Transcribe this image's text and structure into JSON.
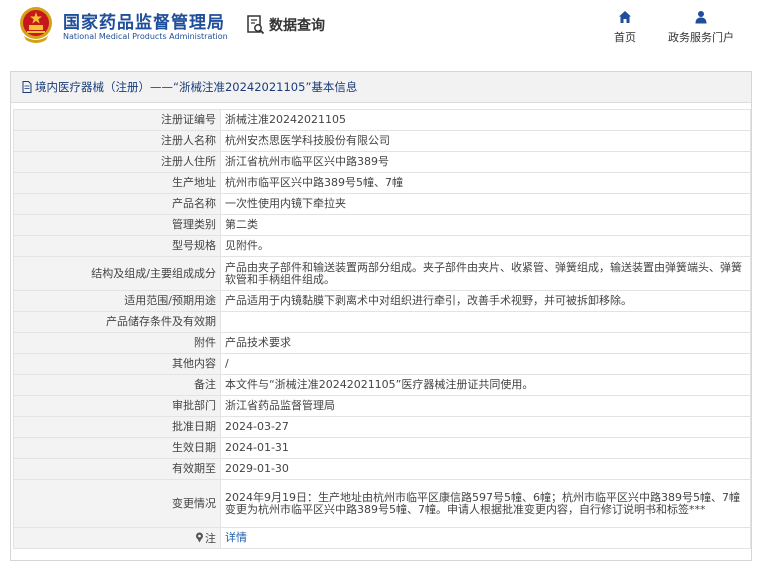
{
  "header": {
    "org_name_cn": "国家药品监督管理局",
    "org_name_en": "National Medical Products Administration",
    "section_title": "数据查询",
    "nav": [
      {
        "label": "首页",
        "icon": "home-icon"
      },
      {
        "label": "政务服务门户",
        "icon": "user-icon"
      }
    ]
  },
  "panel": {
    "title": "境内医疗器械（注册）——“浙械注准20242021105”基本信息"
  },
  "rows": [
    {
      "label": "注册证编号",
      "value": "浙械注准20242021105"
    },
    {
      "label": "注册人名称",
      "value": "杭州安杰思医学科技股份有限公司"
    },
    {
      "label": "注册人住所",
      "value": "浙江省杭州市临平区兴中路389号"
    },
    {
      "label": "生产地址",
      "value": "杭州市临平区兴中路389号5幢、7幢"
    },
    {
      "label": "产品名称",
      "value": "一次性使用内镜下牵拉夹"
    },
    {
      "label": "管理类别",
      "value": "第二类"
    },
    {
      "label": "型号规格",
      "value": "见附件。"
    },
    {
      "label": "结构及组成/主要组成成分",
      "value": "产品由夹子部件和输送装置两部分组成。夹子部件由夹片、收紧管、弹簧组成，输送装置由弹簧端头、弹簧软管和手柄组件组成。"
    },
    {
      "label": "适用范围/预期用途",
      "value": "产品适用于内镜黏膜下剥离术中对组织进行牵引，改善手术视野，并可被拆卸移除。"
    },
    {
      "label": "产品储存条件及有效期",
      "value": ""
    },
    {
      "label": "附件",
      "value": "产品技术要求"
    },
    {
      "label": "其他内容",
      "value": "/"
    },
    {
      "label": "备注",
      "value": "本文件与“浙械注准20242021105”医疗器械注册证共同使用。"
    },
    {
      "label": "审批部门",
      "value": "浙江省药品监督管理局"
    },
    {
      "label": "批准日期",
      "value": "2024-03-27"
    },
    {
      "label": "生效日期",
      "value": "2024-01-31"
    },
    {
      "label": "有效期至",
      "value": "2029-01-30"
    },
    {
      "label": "变更情况",
      "value": "2024年9月19日：生产地址由杭州市临平区康信路597号5幢、6幢；杭州市临平区兴中路389号5幢、7幢变更为杭州市临平区兴中路389号5幢、7幢。申请人根据批准变更内容，自行修订说明书和标签***"
    }
  ],
  "note": {
    "label": "注",
    "link_text": "详情"
  }
}
